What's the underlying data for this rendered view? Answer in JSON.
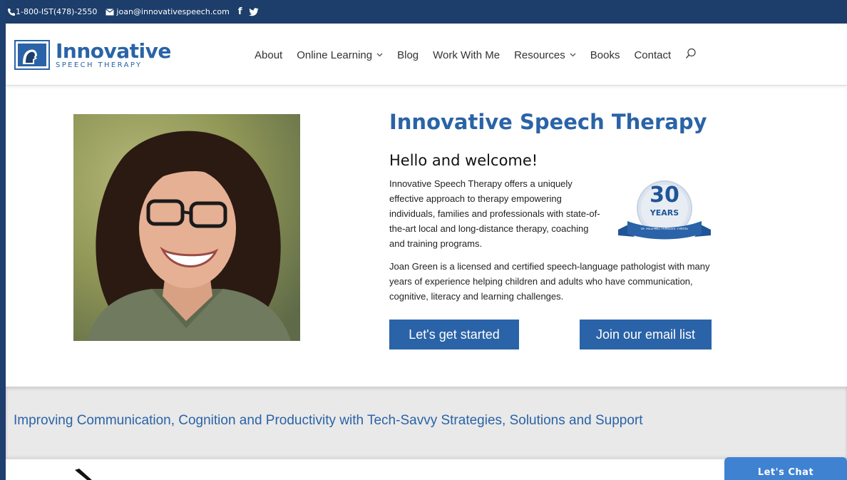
{
  "topbar": {
    "phone": "1-800-IST(478)-2550",
    "email": "joan@innovativespeech.com",
    "icons": [
      "phone-icon",
      "mail-icon",
      "facebook-icon",
      "twitter-icon"
    ],
    "facebook_glyph": "f"
  },
  "logo": {
    "title": "Innovative",
    "subtitle": "SPEECH THERAPY"
  },
  "nav": {
    "items": [
      {
        "label": "About"
      },
      {
        "label": "Online Learning",
        "has_dropdown": true
      },
      {
        "label": "Blog"
      },
      {
        "label": "Work With Me"
      },
      {
        "label": "Resources",
        "has_dropdown": true
      },
      {
        "label": "Books"
      },
      {
        "label": "Contact"
      }
    ]
  },
  "hero": {
    "title": "Innovative Speech Therapy",
    "welcome": "Hello and welcome!",
    "intro": "Innovative Speech Therapy offers a uniquely effective approach to therapy empowering individuals, families and professionals with state-of-the-art local and long-distance therapy, coaching and training programs.",
    "bio": "Joan Green is a licensed and certified speech-language pathologist with many years of experience helping children and adults who have communication, cognitive, literacy and learning challenges.",
    "badge_number": "30",
    "badge_label": "YEARS",
    "badge_ribbon": "OF HELPING FAMILIES THRIVE",
    "btn_primary": "Let's get started",
    "btn_secondary": "Join our email list"
  },
  "banner": {
    "text": "Improving Communication, Cognition and Productivity with Tech-Savvy Strategies, Solutions and Support"
  },
  "chat": {
    "label": "Let's Chat"
  },
  "colors": {
    "brand": "#2a63a7",
    "topbar": "#1d3e6b",
    "banner_bg": "#e9e9e9",
    "chat": "#3f82d2"
  }
}
